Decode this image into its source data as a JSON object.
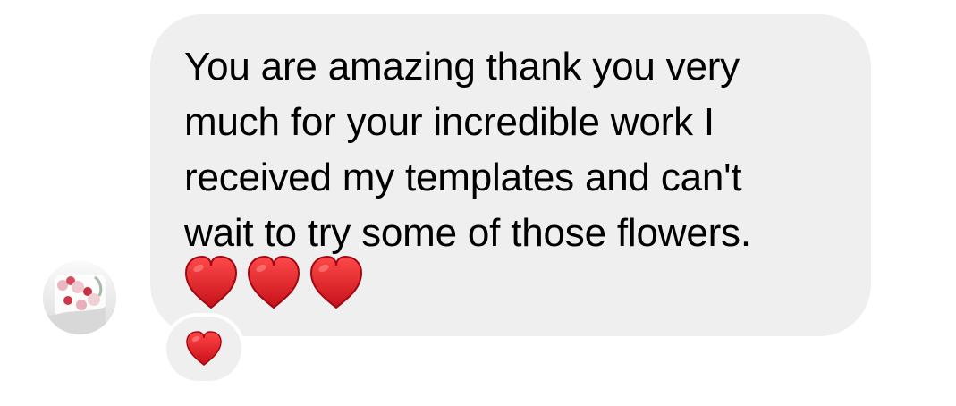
{
  "conversation": {
    "incoming_message": {
      "text": "You are amazing thank you very\nmuch for your incredible work I\nreceived my templates and can't\nwait to try some of those flowers.",
      "emoji": [
        "red-heart-emoji",
        "red-heart-emoji",
        "red-heart-emoji"
      ]
    },
    "sender": {
      "avatar_icon": "flower-cake-avatar"
    },
    "reaction": {
      "emoji": "red-heart-emoji"
    }
  },
  "colors": {
    "background": "#ffffff",
    "bubble": "#efefef",
    "heart": "#d61d24",
    "text": "#000000"
  }
}
